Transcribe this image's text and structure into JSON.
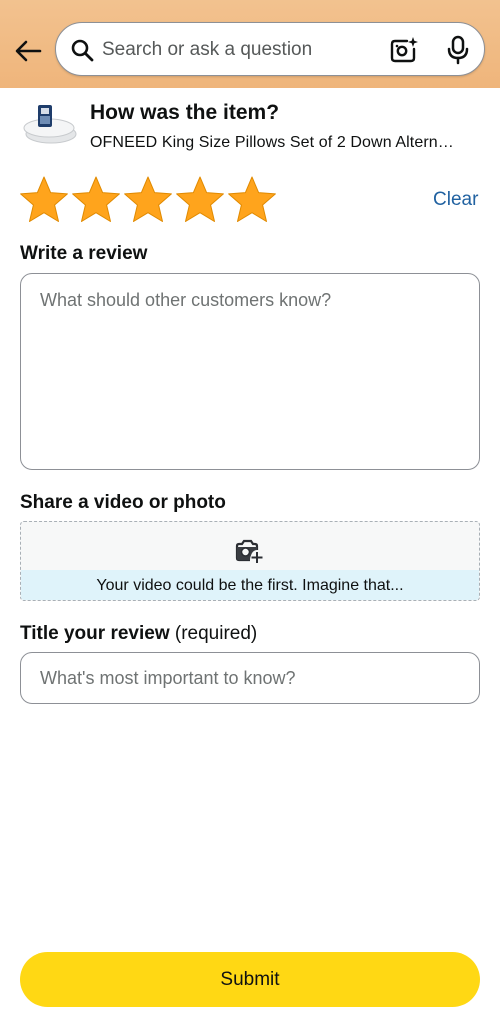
{
  "header": {
    "back_icon": "arrow-left-icon",
    "search": {
      "placeholder": "Search or ask a question",
      "value": ""
    },
    "camera_icon": "camera-sparkle-icon",
    "mic_icon": "microphone-icon"
  },
  "product": {
    "question": "How was the item?",
    "name": "OFNEED King Size Pillows Set of 2 Down Altern…",
    "thumbnail_icon": "pillow-product-image"
  },
  "rating": {
    "value": 5,
    "max": 5,
    "star_color": "#ffa41c",
    "clear_label": "Clear"
  },
  "review": {
    "label": "Write a review",
    "placeholder": "What should other customers know?",
    "value": ""
  },
  "media": {
    "label": "Share a video or photo",
    "icon": "camera-add-icon",
    "banner_text": "Your video could be the first. Imagine that..."
  },
  "title": {
    "label": "Title your review",
    "label_suffix": "(required)",
    "placeholder": "What's most important to know?",
    "value": ""
  },
  "submit_label": "Submit",
  "colors": {
    "header_bg": "#efb57b",
    "link": "#2162a1",
    "submit_bg": "#ffd814",
    "banner_bg": "#dff3fa"
  }
}
